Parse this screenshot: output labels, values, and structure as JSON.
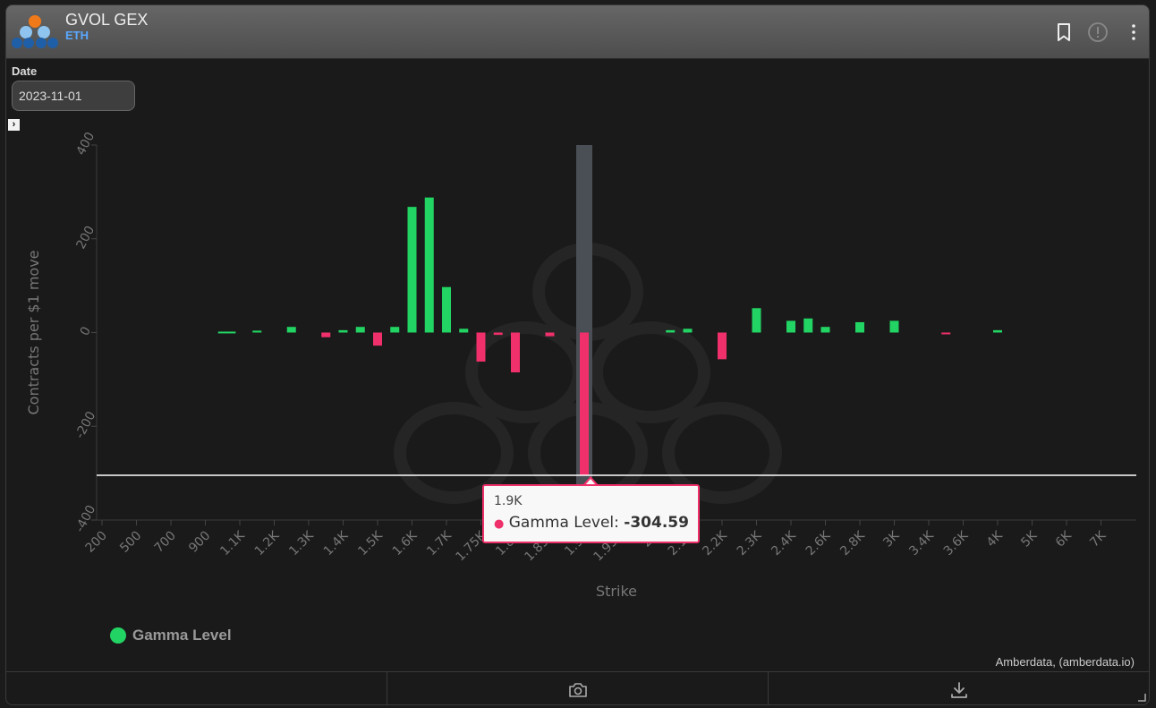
{
  "app": {
    "title": "GVOL GEX",
    "subtitle": "ETH"
  },
  "filters": {
    "date_label": "Date",
    "date_value": "2023-11-01"
  },
  "expander": {
    "glyph": "›"
  },
  "icons": {
    "logo": "gvol-logo-icon",
    "bookmark": "bookmark-icon",
    "info": "alert-circle-icon",
    "menu": "kebab-menu-icon",
    "camera": "camera-icon",
    "download": "download-icon",
    "resize": "resize-corner-icon"
  },
  "colors": {
    "positive": "#22d463",
    "negative": "#f0306a",
    "background": "#1a1a1a"
  },
  "chart_data": {
    "type": "bar",
    "title": "",
    "xlabel": "Strike",
    "ylabel": "Contracts per $1 move",
    "ylim": [
      -400,
      400
    ],
    "yticks": [
      400,
      200,
      0,
      -200,
      -400
    ],
    "categories": [
      "200",
      "500",
      "700",
      "900",
      "1.1K",
      "1.2K",
      "1.3K",
      "1.4K",
      "1.5K",
      "1.6K",
      "1.7K",
      "1.75K",
      "1.8K",
      "1.85K",
      "1.9K",
      "1.95K",
      "2K",
      "2.1K",
      "2.2K",
      "2.3K",
      "2.4K",
      "2.6K",
      "2.8K",
      "3K",
      "3.4K",
      "3.6K",
      "4K",
      "5K",
      "6K",
      "7K"
    ],
    "bars": [
      {
        "x": 1000,
        "value": 2
      },
      {
        "x": 1050,
        "value": 2
      },
      {
        "x": 1150,
        "value": 4
      },
      {
        "x": 1250,
        "value": 12
      },
      {
        "x": 1350,
        "value": -10
      },
      {
        "x": 1400,
        "value": 5
      },
      {
        "x": 1450,
        "value": 12
      },
      {
        "x": 1500,
        "value": -28
      },
      {
        "x": 1550,
        "value": 12
      },
      {
        "x": 1600,
        "value": 268
      },
      {
        "x": 1650,
        "value": 288
      },
      {
        "x": 1700,
        "value": 97
      },
      {
        "x": 1725,
        "value": 8
      },
      {
        "x": 1750,
        "value": -62
      },
      {
        "x": 1775,
        "value": -5
      },
      {
        "x": 1800,
        "value": -85
      },
      {
        "x": 1850,
        "value": -8
      },
      {
        "x": 1900,
        "value": -304.59
      },
      {
        "x": 2050,
        "value": 5
      },
      {
        "x": 2100,
        "value": 8
      },
      {
        "x": 2200,
        "value": -57
      },
      {
        "x": 2300,
        "value": 52
      },
      {
        "x": 2400,
        "value": 25
      },
      {
        "x": 2500,
        "value": 30
      },
      {
        "x": 2600,
        "value": 12
      },
      {
        "x": 2800,
        "value": 22
      },
      {
        "x": 3000,
        "value": 25
      },
      {
        "x": 3500,
        "value": -3
      },
      {
        "x": 4000,
        "value": 5
      }
    ],
    "series": [
      {
        "name": "Gamma Level"
      }
    ],
    "reference_line": -304.59,
    "highlighted_x": 1900,
    "grid": false,
    "legend_position": "bottom-left"
  },
  "tooltip": {
    "x_label": "1.9K",
    "series_name": "Gamma Level:",
    "value": "-304.59"
  },
  "credits": "Amberdata, (amberdata.io)"
}
